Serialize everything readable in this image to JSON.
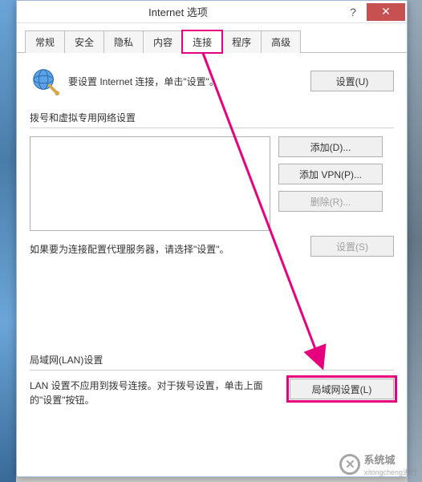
{
  "window": {
    "title": "Internet 选项",
    "help_symbol": "?",
    "close_symbol": "✕"
  },
  "tabs": [
    {
      "label": "常规"
    },
    {
      "label": "安全"
    },
    {
      "label": "隐私"
    },
    {
      "label": "内容"
    },
    {
      "label": "连接"
    },
    {
      "label": "程序"
    },
    {
      "label": "高级"
    }
  ],
  "intro": {
    "text": "要设置 Internet 连接，单击\"设置\"。",
    "setup_btn": "设置(U)"
  },
  "dialup": {
    "group_label": "拨号和虚拟专用网络设置",
    "add_btn": "添加(D)...",
    "add_vpn_btn": "添加 VPN(P)...",
    "remove_btn": "删除(R)...",
    "settings_btn": "设置(S)",
    "note": "如果要为连接配置代理服务器，请选择\"设置\"。"
  },
  "lan": {
    "group_label": "局域网(LAN)设置",
    "text": "LAN 设置不应用到拨号连接。对于拨号设置，单击上面的\"设置\"按钮。",
    "btn": "局域网设置(L)"
  },
  "watermark": {
    "symbol": "✕",
    "text": "系统城",
    "sub": "xitongcheng进行"
  },
  "annotation": {
    "color": "#e6007e"
  }
}
